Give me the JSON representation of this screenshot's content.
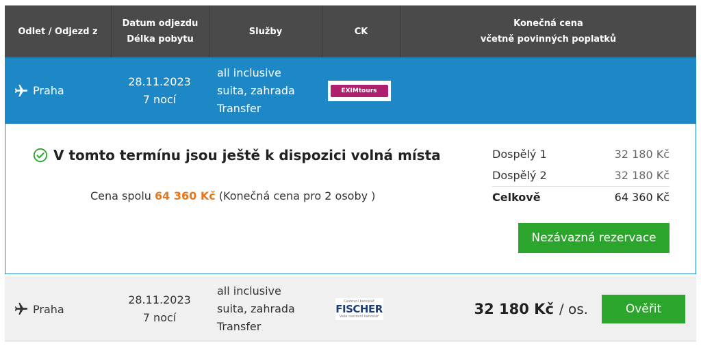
{
  "header": {
    "col_departure": "Odlet / Odjezd z",
    "col_date_line1": "Datum odjezdu",
    "col_date_line2": "Délka pobytu",
    "col_services": "Služby",
    "col_agency": "CK",
    "col_price_line1": "Konečná cena",
    "col_price_line2": "včetně povinných poplatků"
  },
  "selected_row": {
    "city": "Praha",
    "date": "28.11.2023",
    "nights": "7 nocí",
    "service1": "all inclusive",
    "service2": "suita, zahrada",
    "service3": "Transfer",
    "agency_logo": "EXIMtours"
  },
  "detail": {
    "availability": "V tomto termínu jsou ještě k dispozici volná místa",
    "total_prefix": "Cena spolu",
    "total_value": "64 360 Kč",
    "total_suffix": "(Konečná cena pro 2 osoby )",
    "prices": [
      {
        "label": "Dospělý 1",
        "value": "32 180 Kč"
      },
      {
        "label": "Dospělý 2",
        "value": "32 180 Kč"
      }
    ],
    "total_label": "Celkově",
    "total_sum": "64 360 Kč",
    "reserve_button": "Nezávazná rezervace"
  },
  "second_row": {
    "city": "Praha",
    "date": "28.11.2023",
    "nights": "7 nocí",
    "service1": "all inclusive",
    "service2": "suita, zahrada",
    "service3": "Transfer",
    "agency_logo_top": "Cestovní kancelář",
    "agency_logo": "FISCHER",
    "agency_logo_bottom": "Vaše cestovní kancelář",
    "price": "32 180 Kč",
    "per": "/ os.",
    "verify_button": "Ověřit"
  },
  "colors": {
    "header_bg": "#4a4a4a",
    "selected_bg": "#1e88c6",
    "accent_orange": "#e8771c",
    "button_green": "#2ca52c"
  },
  "icons": [
    "plane-icon",
    "check-circle-icon"
  ]
}
